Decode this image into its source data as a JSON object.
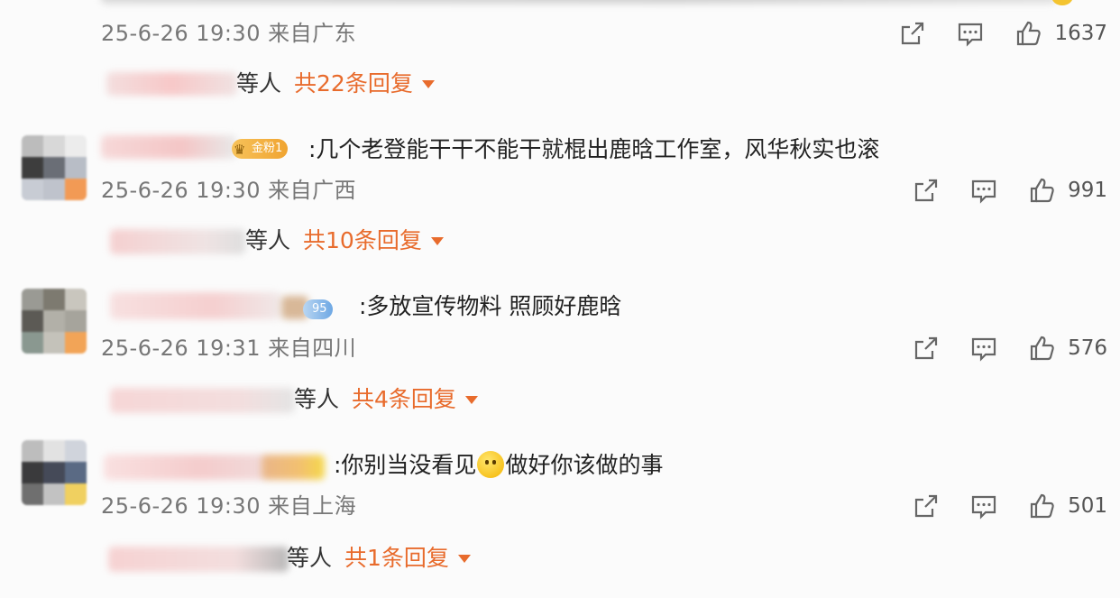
{
  "comments": [
    {
      "content": "",
      "meta": "25-6-26 19:30 来自广东",
      "likes": "1637",
      "reply_suffix": "等人",
      "reply_count": "共22条回复"
    },
    {
      "badge": "金粉1",
      "content": ":几个老登能干干不能干就棍出鹿晗工作室，风华秋实也滚",
      "meta": "25-6-26 19:30 来自广西",
      "likes": "991",
      "reply_suffix": "等人",
      "reply_count": "共10条回复"
    },
    {
      "badge": "95",
      "content": ":多放宣传物料 照顾好鹿晗",
      "meta": "25-6-26 19:31 来自四川",
      "likes": "576",
      "reply_suffix": "等人",
      "reply_count": "共4条回复"
    },
    {
      "content_a": ":你别当没看见",
      "content_b": "做好你该做的事",
      "meta": "25-6-26 19:30 来自上海",
      "likes": "501",
      "reply_suffix": "等人",
      "reply_count": "共1条回复"
    }
  ],
  "icons": {
    "share": "share-icon",
    "comment": "comment-icon",
    "like": "like-icon",
    "emoji": "smile-emoji"
  },
  "colors": {
    "accent": "#e86b2c",
    "meta": "#777777",
    "text": "#222222",
    "badge_gold": "#f2b84b",
    "badge_blue": "#7fb4e8"
  }
}
